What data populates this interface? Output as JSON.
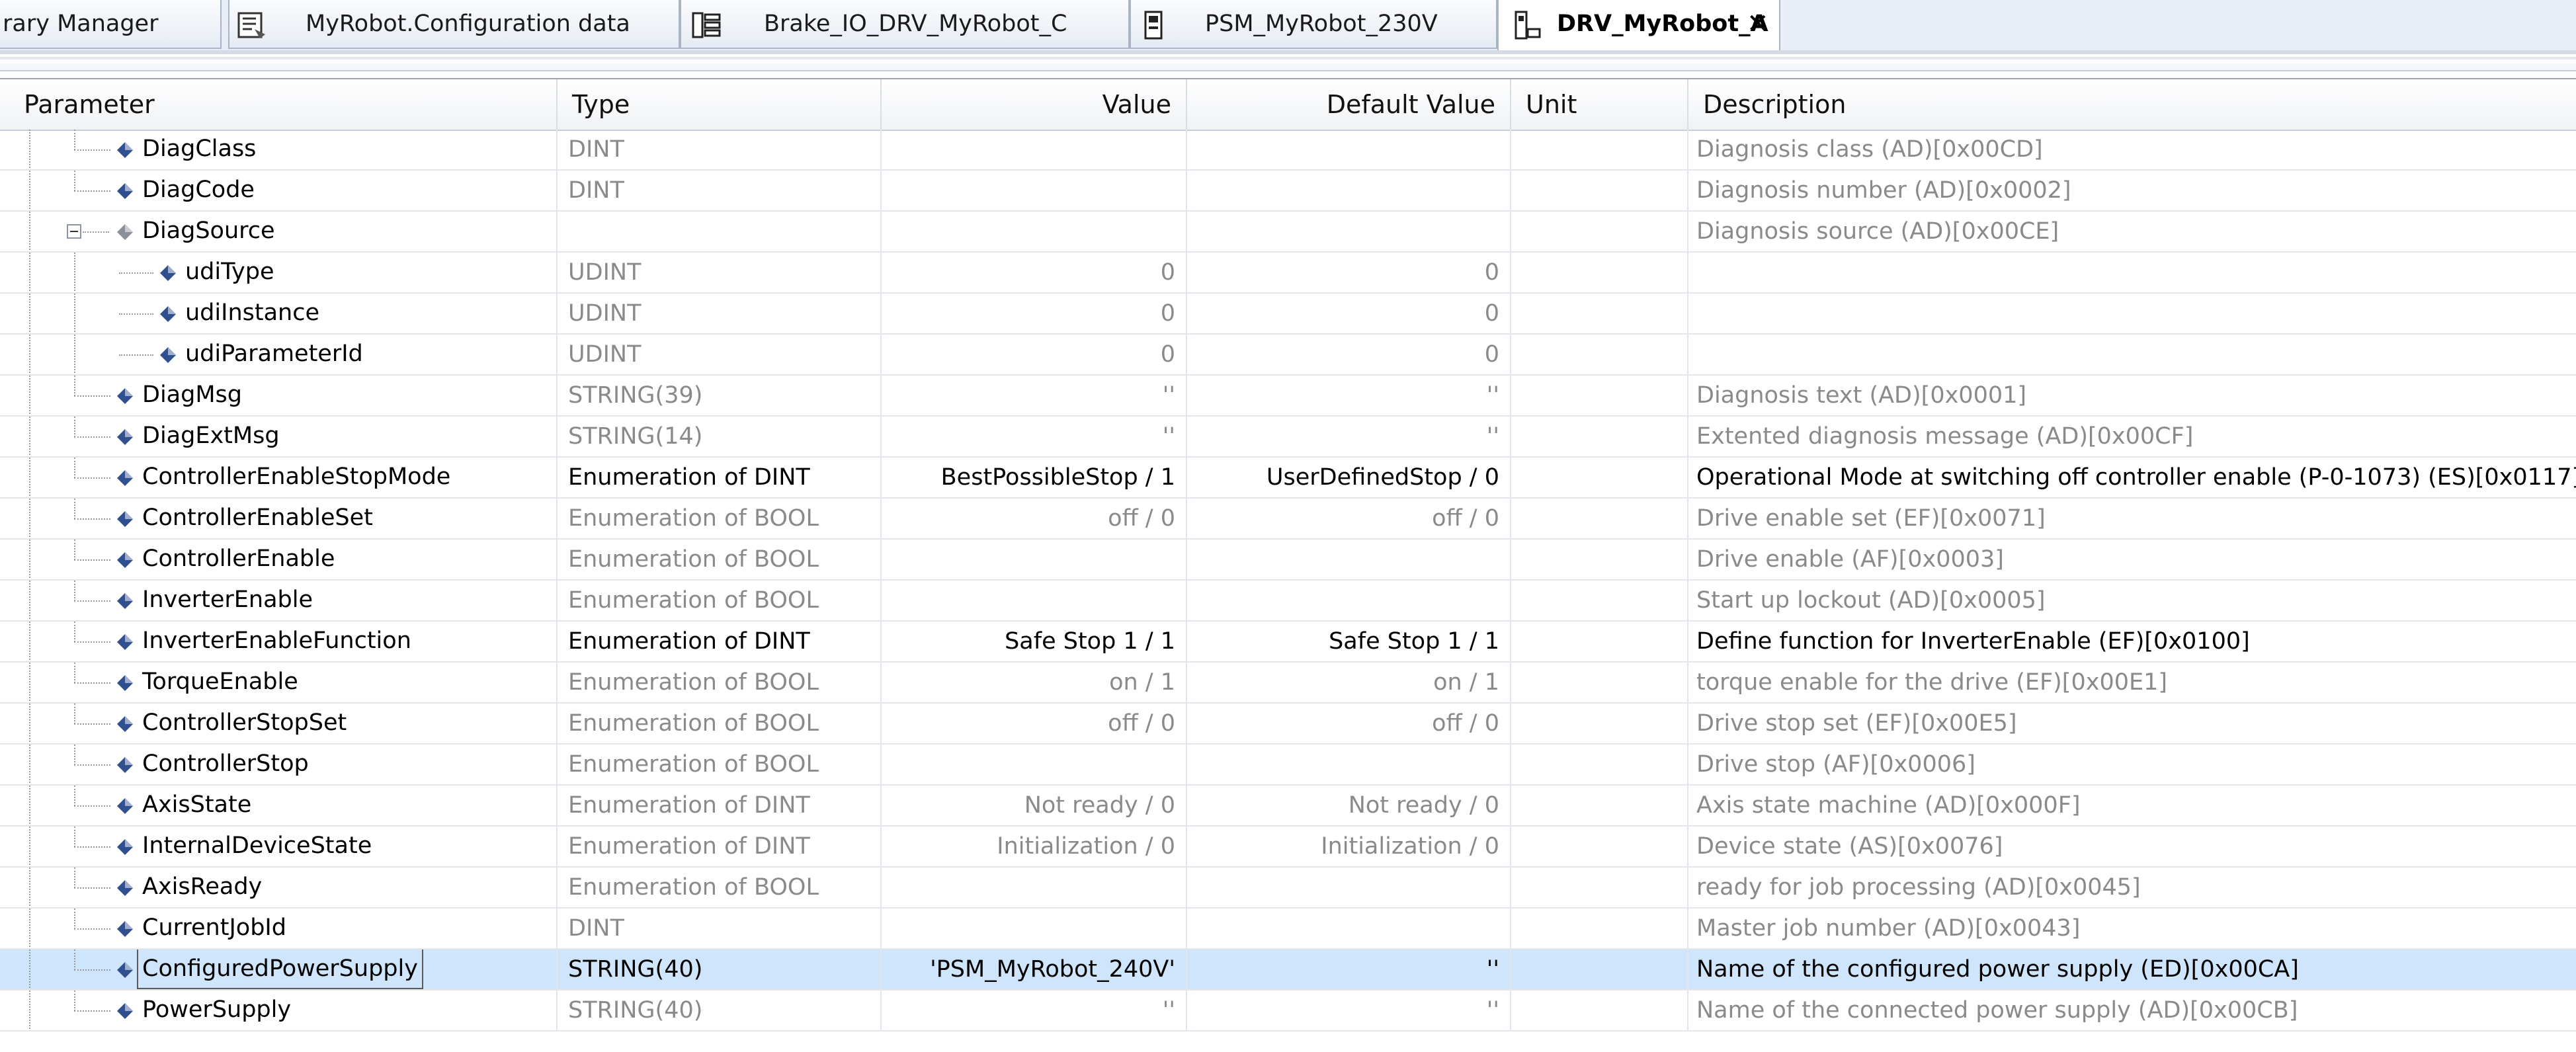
{
  "tabs": [
    {
      "label": "rary Manager",
      "icon": "library-icon",
      "active": false
    },
    {
      "label": "MyRobot.Configuration data",
      "icon": "configuration-data-icon",
      "active": false
    },
    {
      "label": "Brake_IO_DRV_MyRobot_C",
      "icon": "io-module-icon",
      "active": false
    },
    {
      "label": "PSM_MyRobot_230V",
      "icon": "power-supply-module-icon",
      "active": false
    },
    {
      "label": "DRV_MyRobot_A",
      "icon": "drive-icon",
      "active": true
    }
  ],
  "columns": {
    "parameter": "Parameter",
    "type": "Type",
    "value": "Value",
    "default_value": "Default Value",
    "unit": "Unit",
    "description": "Description"
  },
  "rows": [
    {
      "name": "DiagClass",
      "type": "DINT",
      "value": "",
      "default": "",
      "unit": "",
      "description": "Diagnosis class (AD)[0x00CD]",
      "level": 1,
      "editable": false
    },
    {
      "name": "DiagCode",
      "type": "DINT",
      "value": "",
      "default": "",
      "unit": "",
      "description": "Diagnosis number (AD)[0x0002]",
      "level": 1,
      "editable": false
    },
    {
      "name": "DiagSource",
      "type": "",
      "value": "",
      "default": "",
      "unit": "",
      "description": "Diagnosis source (AD)[0x00CE]",
      "level": 1,
      "editable": false,
      "expanded": true
    },
    {
      "name": "udiType",
      "type": "UDINT",
      "value": "0",
      "default": "0",
      "unit": "",
      "description": "",
      "level": 2,
      "editable": false
    },
    {
      "name": "udiInstance",
      "type": "UDINT",
      "value": "0",
      "default": "0",
      "unit": "",
      "description": "",
      "level": 2,
      "editable": false
    },
    {
      "name": "udiParameterId",
      "type": "UDINT",
      "value": "0",
      "default": "0",
      "unit": "",
      "description": "",
      "level": 2,
      "editable": false
    },
    {
      "name": "DiagMsg",
      "type": "STRING(39)",
      "value": "''",
      "default": "''",
      "unit": "",
      "description": "Diagnosis text (AD)[0x0001]",
      "level": 1,
      "editable": false
    },
    {
      "name": "DiagExtMsg",
      "type": "STRING(14)",
      "value": "''",
      "default": "''",
      "unit": "",
      "description": "Extented diagnosis message (AD)[0x00CF]",
      "level": 1,
      "editable": false
    },
    {
      "name": "ControllerEnableStopMode",
      "type": "Enumeration of DINT",
      "value": "BestPossibleStop / 1",
      "default": "UserDefinedStop / 0",
      "unit": "",
      "description": "Operational Mode at switching off controller enable (P-0-1073) (ES)[0x0117]",
      "level": 1,
      "editable": true
    },
    {
      "name": "ControllerEnableSet",
      "type": "Enumeration of BOOL",
      "value": "off / 0",
      "default": "off / 0",
      "unit": "",
      "description": "Drive enable set (EF)[0x0071]",
      "level": 1,
      "editable": false
    },
    {
      "name": "ControllerEnable",
      "type": "Enumeration of BOOL",
      "value": "",
      "default": "",
      "unit": "",
      "description": "Drive enable (AF)[0x0003]",
      "level": 1,
      "editable": false
    },
    {
      "name": "InverterEnable",
      "type": "Enumeration of BOOL",
      "value": "",
      "default": "",
      "unit": "",
      "description": "Start up lockout (AD)[0x0005]",
      "level": 1,
      "editable": false
    },
    {
      "name": "InverterEnableFunction",
      "type": "Enumeration of DINT",
      "value": "Safe Stop 1 / 1",
      "default": "Safe Stop 1 / 1",
      "unit": "",
      "description": "Define function for InverterEnable (EF)[0x0100]",
      "level": 1,
      "editable": true
    },
    {
      "name": "TorqueEnable",
      "type": "Enumeration of BOOL",
      "value": "on / 1",
      "default": "on / 1",
      "unit": "",
      "description": "torque enable for the drive (EF)[0x00E1]",
      "level": 1,
      "editable": false
    },
    {
      "name": "ControllerStopSet",
      "type": "Enumeration of BOOL",
      "value": "off / 0",
      "default": "off / 0",
      "unit": "",
      "description": "Drive stop set (EF)[0x00E5]",
      "level": 1,
      "editable": false
    },
    {
      "name": "ControllerStop",
      "type": "Enumeration of BOOL",
      "value": "",
      "default": "",
      "unit": "",
      "description": "Drive stop (AF)[0x0006]",
      "level": 1,
      "editable": false
    },
    {
      "name": "AxisState",
      "type": "Enumeration of DINT",
      "value": "Not ready / 0",
      "default": "Not ready / 0",
      "unit": "",
      "description": "Axis state machine (AD)[0x000F]",
      "level": 1,
      "editable": false
    },
    {
      "name": "InternalDeviceState",
      "type": "Enumeration of DINT",
      "value": "Initialization / 0",
      "default": "Initialization / 0",
      "unit": "",
      "description": "Device state (AS)[0x0076]",
      "level": 1,
      "editable": false
    },
    {
      "name": "AxisReady",
      "type": "Enumeration of BOOL",
      "value": "",
      "default": "",
      "unit": "",
      "description": "ready for job processing (AD)[0x0045]",
      "level": 1,
      "editable": false
    },
    {
      "name": "CurrentJobId",
      "type": "DINT",
      "value": "",
      "default": "",
      "unit": "",
      "description": "Master job number (AD)[0x0043]",
      "level": 1,
      "editable": false
    },
    {
      "name": "ConfiguredPowerSupply",
      "type": "STRING(40)",
      "value": "'PSM_MyRobot_240V'",
      "default": "''",
      "unit": "",
      "description": "Name of the configured power supply (ED)[0x00CA]",
      "level": 1,
      "editable": true,
      "selected": true
    },
    {
      "name": "PowerSupply",
      "type": "STRING(40)",
      "value": "''",
      "default": "''",
      "unit": "",
      "description": "Name of the connected power supply (AD)[0x00CB]",
      "level": 1,
      "editable": false
    }
  ],
  "colors": {
    "selected_row": "#cfe5fb",
    "readonly_text": "#8a8a8a",
    "editable_text": "#000000",
    "param_icon": "#2f4f8f"
  }
}
